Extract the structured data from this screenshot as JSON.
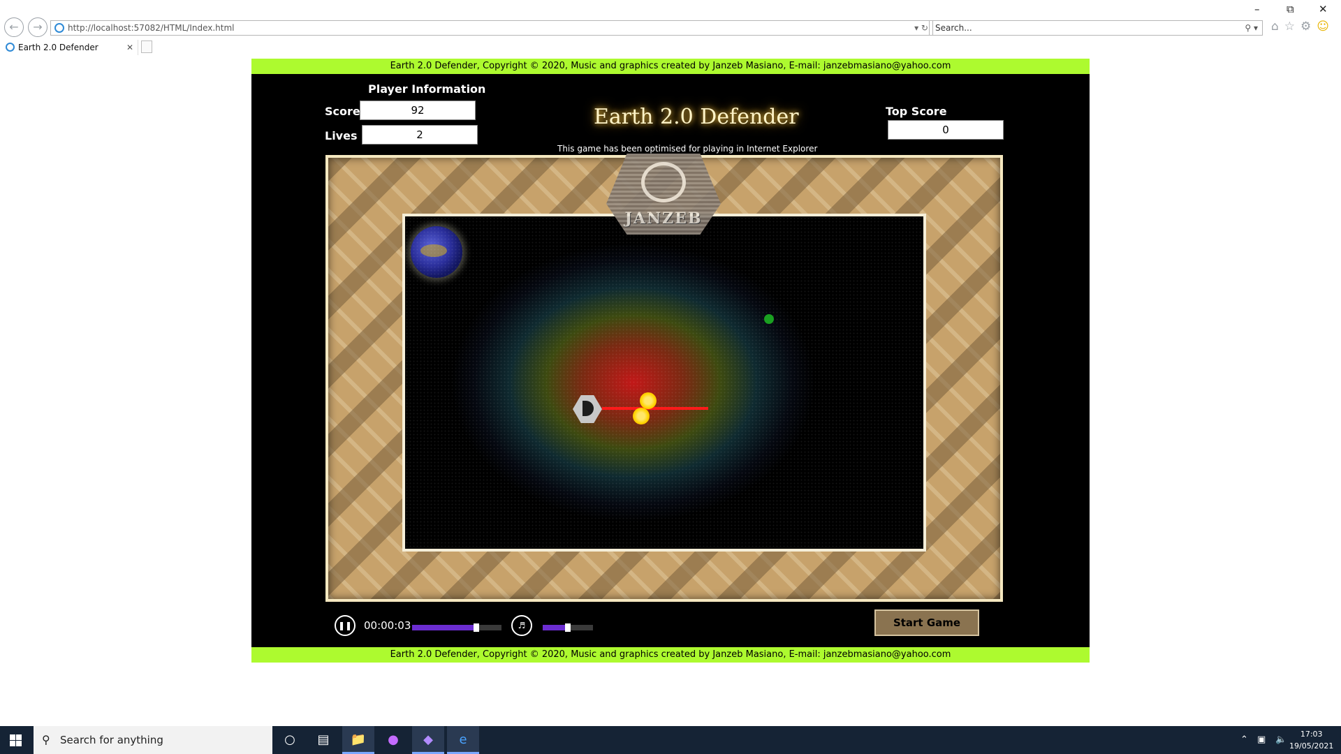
{
  "browser": {
    "url": "http://localhost:57082/HTML/Index.html",
    "search_placeholder": "Search...",
    "tab_title": "Earth 2.0 Defender"
  },
  "page": {
    "banner_text": "Earth 2.0 Defender, Copyright © 2020, Music and graphics created by Janzeb Masiano, E-mail: janzebmasiano@yahoo.com",
    "player_info_title": "Player Information",
    "score_label": "Score",
    "score_value": "92",
    "lives_label": "Lives",
    "lives_value": "2",
    "game_title": "Earth 2.0 Defender",
    "optimised_note": "This game has been optimised for playing in Internet Explorer",
    "top_score_label": "Top Score",
    "top_score_value": "0",
    "logo_text": "JANZEB",
    "time": "00:00:03",
    "music_progress": 0.72,
    "volume_level": 0.5,
    "start_button": "Start Game"
  },
  "taskbar": {
    "search_placeholder": "Search for anything",
    "time": "17:03",
    "date": "19/05/2021"
  },
  "colors": {
    "banner": "#adfa2f",
    "game_bg": "#000000",
    "accent_purple": "#6b2dd1",
    "button_brown": "#8a7350",
    "laser_red": "#ff1a1a",
    "alien_green": "#1aa021"
  },
  "icons": [
    "back-icon",
    "forward-icon",
    "refresh-icon",
    "search-icon",
    "home-icon",
    "star-icon",
    "gear-icon",
    "smiley-icon",
    "pause-icon",
    "volume-icon",
    "windows-icon",
    "cortana-icon",
    "task-view-icon",
    "file-explorer-icon",
    "visual-studio-icon",
    "edge-icon"
  ]
}
